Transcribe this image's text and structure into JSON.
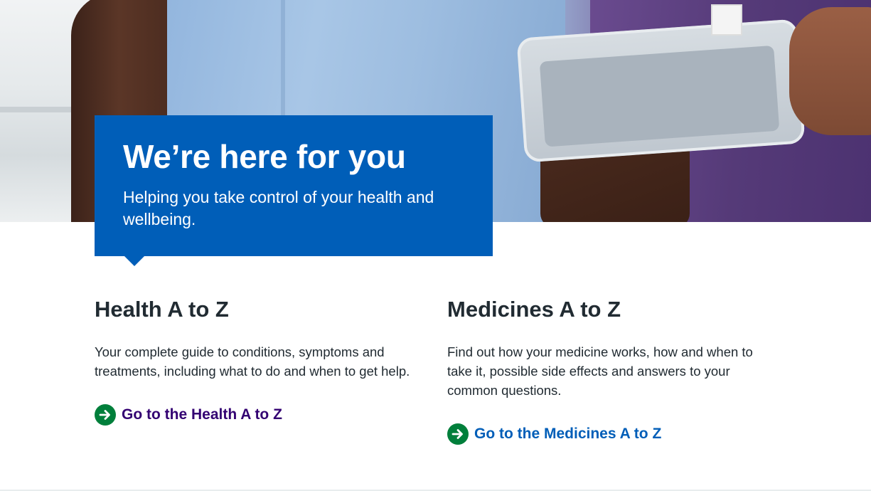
{
  "hero": {
    "title": "We’re here for you",
    "lede": "Helping you take control of your health and wellbeing."
  },
  "cards": [
    {
      "title": "Health A to Z",
      "description": "Your complete guide to conditions, symptoms and treatments, including what to do and when to get help.",
      "action_label": "Go to the Health A to Z",
      "action_icon": "arrow-right-circle-icon"
    },
    {
      "title": "Medicines A to Z",
      "description": "Find out how your medicine works, how and when to take it, possible side effects and answers to your common questions.",
      "action_label": "Go to the Medicines A to Z",
      "action_icon": "arrow-right-circle-icon"
    }
  ],
  "colors": {
    "nhs_blue": "#005eb8",
    "action_green": "#007f3b",
    "visited_link_purple": "#330072",
    "text": "#212b32"
  }
}
